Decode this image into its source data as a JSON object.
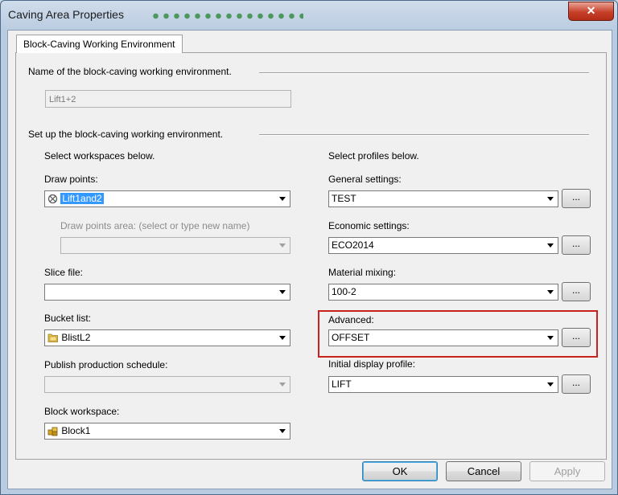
{
  "window": {
    "title": "Caving Area Properties",
    "close_glyph": "✕"
  },
  "tab": {
    "label": "Block-Caving Working Environment"
  },
  "name_section": {
    "label": "Name of the block-caving working environment.",
    "value": "Lift1+2"
  },
  "setup_section": {
    "label": "Set up the block-caving working environment."
  },
  "workspaces": {
    "heading": "Select workspaces below.",
    "draw_points": {
      "label": "Draw points:",
      "value": "Lift1and2",
      "icon": "no-entry-circle-icon"
    },
    "draw_points_area": {
      "label": "Draw points area: (select or type new name)",
      "value": ""
    },
    "slice_file": {
      "label": "Slice file:",
      "value": ""
    },
    "bucket_list": {
      "label": "Bucket list:",
      "value": "BlistL2",
      "icon": "folder-icon"
    },
    "publish_schedule": {
      "label": "Publish production schedule:",
      "value": ""
    },
    "block_workspace": {
      "label": "Block workspace:",
      "value": "Block1",
      "icon": "block-cubes-icon"
    }
  },
  "profiles": {
    "heading": "Select profiles below.",
    "general": {
      "label": "General settings:",
      "value": "TEST"
    },
    "economic": {
      "label": "Economic settings:",
      "value": "ECO2014"
    },
    "material": {
      "label": "Material mixing:",
      "value": "100-2"
    },
    "advanced": {
      "label": "Advanced:",
      "value": "OFFSET"
    },
    "initial_display": {
      "label": "Initial display profile:",
      "value": "LIFT"
    },
    "browse_label": "..."
  },
  "buttons": {
    "ok": "OK",
    "cancel": "Cancel",
    "apply": "Apply"
  },
  "colors": {
    "highlight_box": "#c8201c",
    "selection": "#3399ff"
  }
}
